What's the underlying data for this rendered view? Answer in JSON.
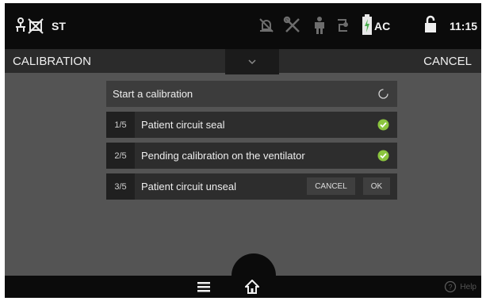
{
  "status_bar": {
    "mode_label": "ST",
    "power_label": "AC",
    "clock": "11:15",
    "icons": [
      "network-crossed-icon",
      "alarm-off-icon",
      "tools-icon",
      "patient-icon",
      "circuit-icon",
      "battery-charging-icon",
      "lock-icon"
    ]
  },
  "title_bar": {
    "title": "CALIBRATION",
    "cancel_label": "CANCEL"
  },
  "calibration": {
    "header_label": "Start a calibration",
    "steps": [
      {
        "number": "1/5",
        "label": "Patient circuit seal",
        "status": "done"
      },
      {
        "number": "2/5",
        "label": "Pending calibration on the ventilator",
        "status": "done"
      },
      {
        "number": "3/5",
        "label": "Patient circuit unseal",
        "status": "pending"
      }
    ],
    "cancel_label": "CANCEL",
    "ok_label": "OK"
  },
  "bottom_bar": {
    "help_label": "Help"
  },
  "colors": {
    "background": "#545454",
    "bar": "#0b0b0b",
    "check": "#8bc53f"
  }
}
